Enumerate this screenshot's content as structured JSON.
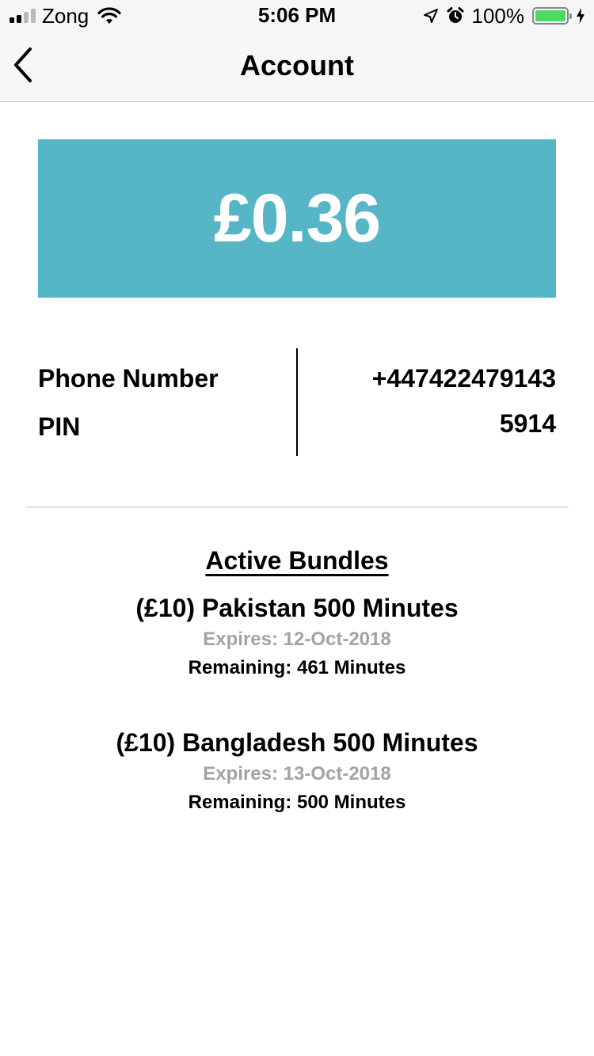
{
  "status_bar": {
    "carrier": "Zong",
    "time": "5:06 PM",
    "battery_percent": "100%",
    "signal_bars": 4,
    "signal_active": 2,
    "icons": [
      "signal-icon",
      "wifi-icon",
      "location-arrow-icon",
      "alarm-clock-icon",
      "battery-icon",
      "charging-bolt-icon"
    ]
  },
  "nav": {
    "title": "Account",
    "back_icon": "chevron-left-icon"
  },
  "balance": {
    "amount": "£0.36",
    "background_color": "#57b6c6"
  },
  "info": {
    "rows": [
      {
        "label": "Phone Number",
        "value": "+447422479143"
      },
      {
        "label": "PIN",
        "value": "5914"
      }
    ]
  },
  "bundles": {
    "heading": "Active Bundles",
    "items": [
      {
        "name": "(£10) Pakistan 500 Minutes",
        "expires": "Expires: 12-Oct-2018",
        "remaining": "Remaining: 461 Minutes"
      },
      {
        "name": "(£10) Bangladesh 500 Minutes",
        "expires": "Expires: 13-Oct-2018",
        "remaining": "Remaining: 500 Minutes"
      }
    ]
  }
}
